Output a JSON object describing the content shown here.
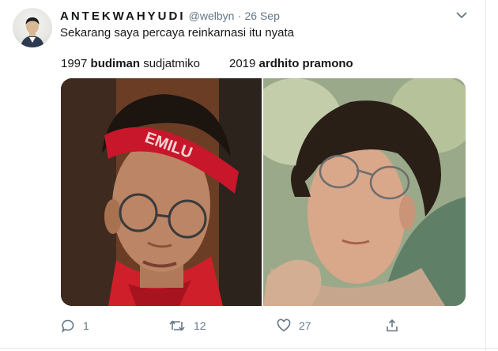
{
  "tweet": {
    "display_name": "ANTEKWAHYUDI",
    "handle": "@welbyn",
    "separator": "·",
    "date": "26 Sep",
    "text": "Sekarang saya percaya reinkarnasi itu nyata"
  },
  "captions": {
    "left": {
      "year": "1997",
      "bold": "budiman",
      "rest": "sudjatmiko"
    },
    "right": {
      "year": "2019",
      "bold": "ardhito pramono"
    }
  },
  "media": {
    "left_photo": "photo-left",
    "right_photo": "photo-right"
  },
  "actions": {
    "reply_count": "1",
    "retweet_count": "12",
    "like_count": "27"
  },
  "colors": {
    "text": "#14171a",
    "secondary": "#657786",
    "divider": "#e1e8ed",
    "headband": "#c8162b"
  },
  "icons": [
    "reply-icon",
    "retweet-icon",
    "like-icon",
    "share-icon",
    "caret-down-icon"
  ]
}
